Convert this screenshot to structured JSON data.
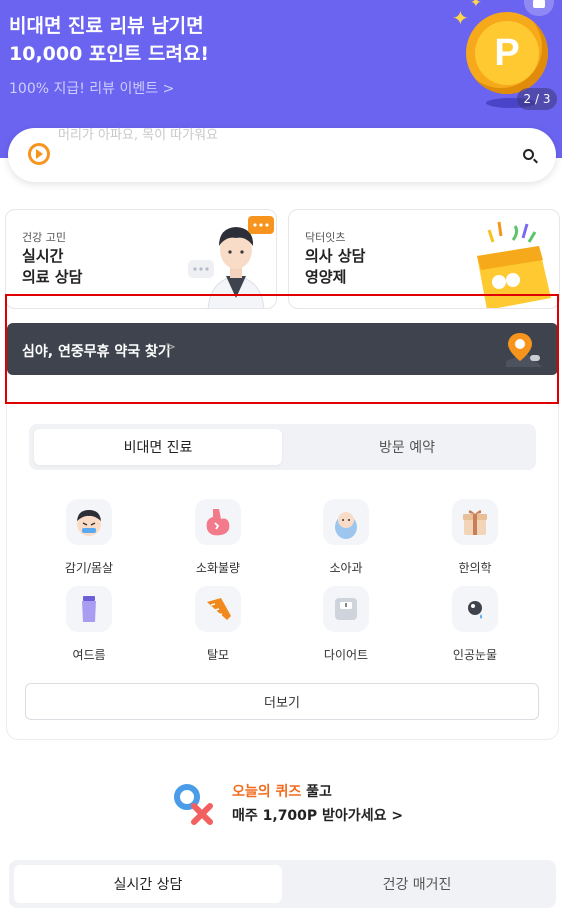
{
  "banner": {
    "title_line1": "비대면 진료 리뷰 남기면",
    "title_line2": "10,000 포인트 드려요!",
    "subtitle": "100% 지급! 리뷰 이벤트 >",
    "pager": "2 / 3",
    "coin_letter": "P"
  },
  "search": {
    "placeholder": "머리가 아파요, 목이 따가워요"
  },
  "cards": {
    "left": {
      "caption": "건강 고민",
      "title_line1": "실시간",
      "title_line2": "의료 상담"
    },
    "right": {
      "caption": "닥터잇츠",
      "title_line1": "의사 상담",
      "title_line2": "영양제"
    }
  },
  "pharmacy": {
    "label": "심야, 연중무휴 약국 찾기",
    "chevron": ">"
  },
  "service_tabs": [
    "비대면 진료",
    "방문 예약"
  ],
  "categories": [
    {
      "label": "감기/몸살",
      "icon": "cold-icon"
    },
    {
      "label": "소화불량",
      "icon": "stomach-icon"
    },
    {
      "label": "소아과",
      "icon": "baby-icon"
    },
    {
      "label": "한의학",
      "icon": "herbal-icon"
    },
    {
      "label": "여드름",
      "icon": "acne-cream-icon"
    },
    {
      "label": "탈모",
      "icon": "comb-icon"
    },
    {
      "label": "다이어트",
      "icon": "scale-icon"
    },
    {
      "label": "인공눈물",
      "icon": "eye-drop-icon"
    }
  ],
  "more_label": "더보기",
  "quiz": {
    "highlight": "오늘의 퀴즈",
    "line1_rest": " 풀고",
    "line2": "매주 1,700P 받아가세요 >"
  },
  "bottom_tabs": [
    "실시간 상담",
    "건강 매거진"
  ],
  "colors": {
    "banner": "#6a64f0",
    "accent_orange": "#f26b1d",
    "highlight_box": "#e00000",
    "pharmacy_bar": "#3e434d"
  }
}
